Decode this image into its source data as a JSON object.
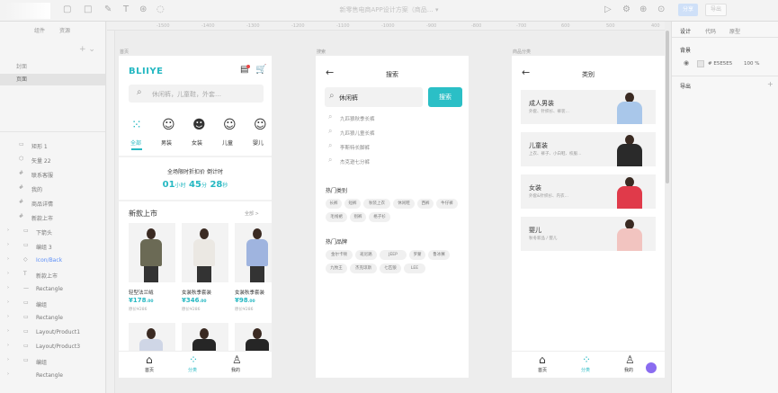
{
  "editor": {
    "doc_title": "新零售电商APP设计方案（商品…  ▾",
    "share_label": "分享",
    "export_label": "导出",
    "left_tabs": [
      "组件",
      "资源"
    ],
    "pages": [
      "封面",
      "页面"
    ],
    "layers": [
      {
        "icon": "▭",
        "name": "矩形 1",
        "indent": 0
      },
      {
        "icon": "⬡",
        "name": "矢量 22",
        "indent": 0
      },
      {
        "icon": "#",
        "name": "联系客服",
        "indent": 0
      },
      {
        "icon": "#",
        "name": "我的",
        "indent": 0
      },
      {
        "icon": "#",
        "name": "商品详情",
        "indent": 0
      },
      {
        "icon": "#",
        "name": "新款上市",
        "indent": 0
      },
      {
        "icon": "▭",
        "name": "下箭头",
        "indent": 1
      },
      {
        "icon": "▭",
        "name": "编组 3",
        "indent": 1
      },
      {
        "icon": "◇",
        "name": "Icon/Back",
        "indent": 1,
        "highlight": true
      },
      {
        "icon": "T",
        "name": "新款上市",
        "indent": 1
      },
      {
        "icon": "—",
        "name": "Rectangle",
        "indent": 1
      },
      {
        "icon": "▭",
        "name": "编组",
        "indent": 1
      },
      {
        "icon": "▭",
        "name": "Rectangle",
        "indent": 1
      },
      {
        "icon": "▭",
        "name": "Layout/Product1",
        "indent": 1
      },
      {
        "icon": "▭",
        "name": "Layout/Product3",
        "indent": 1
      },
      {
        "icon": "▭",
        "name": "编组",
        "indent": 1
      },
      {
        "icon": "",
        "name": "Rectangle",
        "indent": 1
      }
    ],
    "ruler_ticks": [
      "-1500",
      "-1400",
      "-1300",
      "-1200",
      "-1100",
      "-1000",
      "-900",
      "-800",
      "-700",
      "600",
      "500",
      "400"
    ],
    "frame_labels": [
      "首页",
      "搜索",
      "商品分类"
    ],
    "right_tabs": [
      "设计",
      "代码",
      "原型"
    ],
    "fill_label": "背景",
    "fill_hex": "# E5E5E5",
    "fill_opacity": "100 %",
    "export_section": "导出"
  },
  "home": {
    "brand": "BLIIYE",
    "search_placeholder": "休闲裤，儿童鞋，外套…",
    "categories": [
      {
        "label": "全部",
        "icon": "grid-icon",
        "active": true
      },
      {
        "label": "男装",
        "icon": "man-icon"
      },
      {
        "label": "女装",
        "icon": "woman-icon"
      },
      {
        "label": "儿童",
        "icon": "child-icon"
      },
      {
        "label": "婴儿",
        "icon": "baby-icon"
      }
    ],
    "promo_title": "全场限时折扣价 倒计时",
    "countdown": {
      "hours": "01",
      "hours_unit": "小时",
      "minutes": "45",
      "minutes_unit": "分",
      "seconds": "28",
      "seconds_unit": "秒"
    },
    "section_title": "新款上市",
    "section_more": "全部 >",
    "products": [
      {
        "name": "轻型法兰绒",
        "price": "¥178",
        "cents": ".00",
        "orig": "原价¥286",
        "color": "#6b6a55"
      },
      {
        "name": "女装秋季套装",
        "price": "¥346",
        "cents": ".00",
        "orig": "原价¥286",
        "color": "#ebe8e3"
      },
      {
        "name": "女装秋季套装",
        "price": "¥98",
        "cents": ".00",
        "orig": "原价¥286",
        "color": "#9fb4df"
      }
    ],
    "tabs": [
      {
        "label": "首页",
        "icon": "home-icon"
      },
      {
        "label": "分类",
        "icon": "category-icon",
        "active": true
      },
      {
        "label": "我的",
        "icon": "user-icon"
      }
    ]
  },
  "search": {
    "title": "搜索",
    "query": "休闲裤",
    "button": "搜索",
    "suggestions": [
      "九匹狼秋季长裤",
      "九匹狼儿童长裤",
      "李斯特长脚裤",
      "杰克逊七分裤"
    ],
    "hot_cat_title": "热门类别",
    "hot_cats": [
      "长裤",
      "短裤",
      "秋装上衣",
      "休闲鞋",
      "西裤",
      "牛仔裤",
      "毛线裙",
      "别裤",
      "格子衫"
    ],
    "hot_brand_title": "热门品牌",
    "hot_brands": [
      "金尔卡顿",
      "班尼路",
      "JEEP",
      "罗蒙",
      "鲁冰赛",
      "九牧王",
      "杰克琼斯",
      "七匹狼",
      "LEE"
    ]
  },
  "category": {
    "title": "类别",
    "items": [
      {
        "title": "成人男装",
        "sub": "外套、针织衫、裤装…",
        "color": "#a9c7ea"
      },
      {
        "title": "儿童装",
        "sub": "上衣、裤子、小白鞋、校服…",
        "color": "#2a2a2a"
      },
      {
        "title": "女装",
        "sub": "外套&针织衫、内衣…",
        "color": "#e03a4a"
      },
      {
        "title": "婴儿",
        "sub": "秋冬新品 / 婴儿",
        "color": "#f2c4c0"
      }
    ],
    "tabs": [
      {
        "label": "首页",
        "icon": "home-icon"
      },
      {
        "label": "分类",
        "icon": "category-icon",
        "active": true
      },
      {
        "label": "我的",
        "icon": "user-icon"
      }
    ]
  },
  "colors": {
    "accent": "#2bbfc6",
    "brand": "#25b8c2",
    "price": "#25b8c2",
    "link": "#5b8ef7"
  }
}
